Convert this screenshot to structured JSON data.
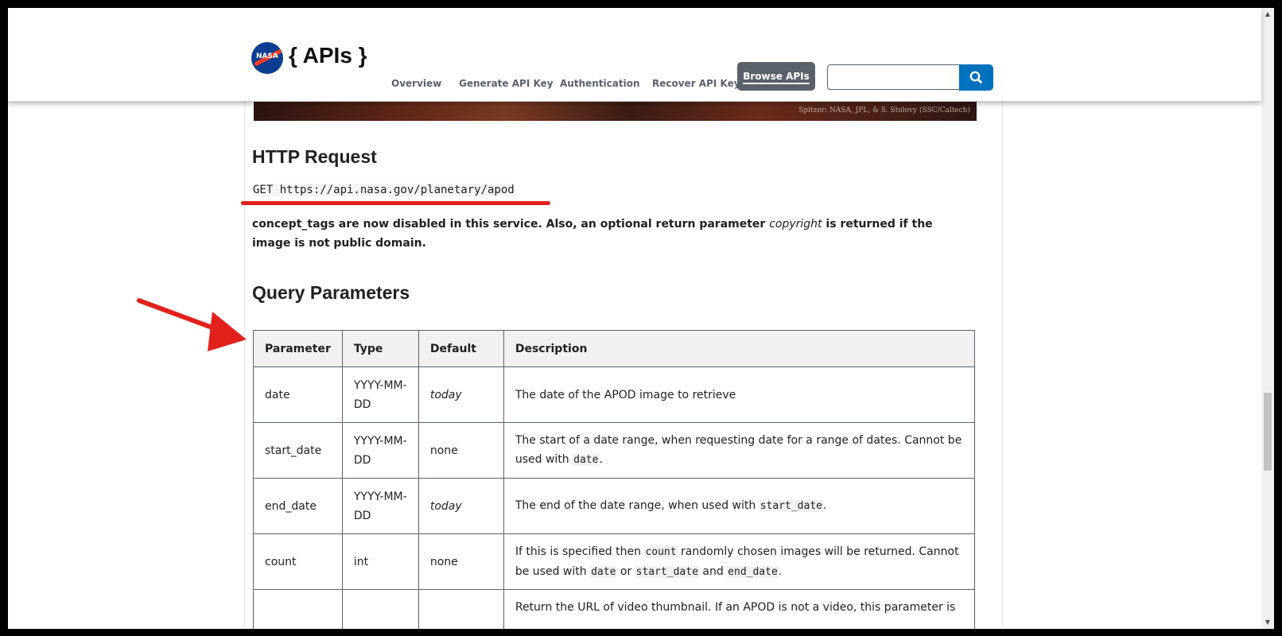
{
  "header": {
    "logo_text": "NASA",
    "brand": "{ APIs }",
    "nav": [
      {
        "label": "Overview"
      },
      {
        "label": "Generate API Key"
      },
      {
        "label": "Authentication"
      },
      {
        "label": "Recover API Key"
      }
    ],
    "browse_label": "Browse APIs",
    "search": {
      "value": "",
      "placeholder": ""
    }
  },
  "hero": {
    "credit": "Spitzer: NASA, JPL, & S. Stolovy (SSC/Caltech)"
  },
  "http_request": {
    "heading": "HTTP Request",
    "code": "GET https://api.nasa.gov/planetary/apod",
    "notice_part1": "concept_tags are now disabled in this service. Also, an optional return parameter ",
    "notice_em": "copyright",
    "notice_part2": " is returned if the image is not public domain."
  },
  "query_params": {
    "heading": "Query Parameters",
    "columns": [
      "Parameter",
      "Type",
      "Default",
      "Description"
    ],
    "rows": [
      {
        "parameter": "date",
        "type": "YYYY-MM-DD",
        "default": "today",
        "default_italic": true,
        "description": [
          {
            "text": "The date of the APOD image to retrieve"
          }
        ]
      },
      {
        "parameter": "start_date",
        "type": "YYYY-MM-DD",
        "default": "none",
        "default_italic": false,
        "description": [
          {
            "text": "The start of a date range, when requesting date for a range of dates. Cannot be used with "
          },
          {
            "code": "date"
          },
          {
            "text": "."
          }
        ]
      },
      {
        "parameter": "end_date",
        "type": "YYYY-MM-DD",
        "default": "today",
        "default_italic": true,
        "description": [
          {
            "text": "The end of the date range, when used with "
          },
          {
            "code": "start_date"
          },
          {
            "text": "."
          }
        ]
      },
      {
        "parameter": "count",
        "type": "int",
        "default": "none",
        "default_italic": false,
        "description": [
          {
            "text": "If this is specified then "
          },
          {
            "code": "count"
          },
          {
            "text": " randomly chosen images will be returned. Cannot be used with "
          },
          {
            "code": "date"
          },
          {
            "text": " or "
          },
          {
            "code": "start_date"
          },
          {
            "text": " and "
          },
          {
            "code": "end_date"
          },
          {
            "text": "."
          }
        ]
      },
      {
        "parameter": "",
        "type": "",
        "default": "",
        "default_italic": false,
        "description": [
          {
            "text": "Return the URL of video thumbnail. If an APOD is not a video, this parameter is"
          }
        ]
      }
    ]
  },
  "colors": {
    "nav_text": "#5b616b",
    "search_button": "#0071bc",
    "annotation": "#e3211c",
    "nasa_blue": "#0b3d91",
    "nasa_red": "#fc3d21"
  },
  "icons": [
    "search-icon",
    "annotation-arrow-icon"
  ]
}
